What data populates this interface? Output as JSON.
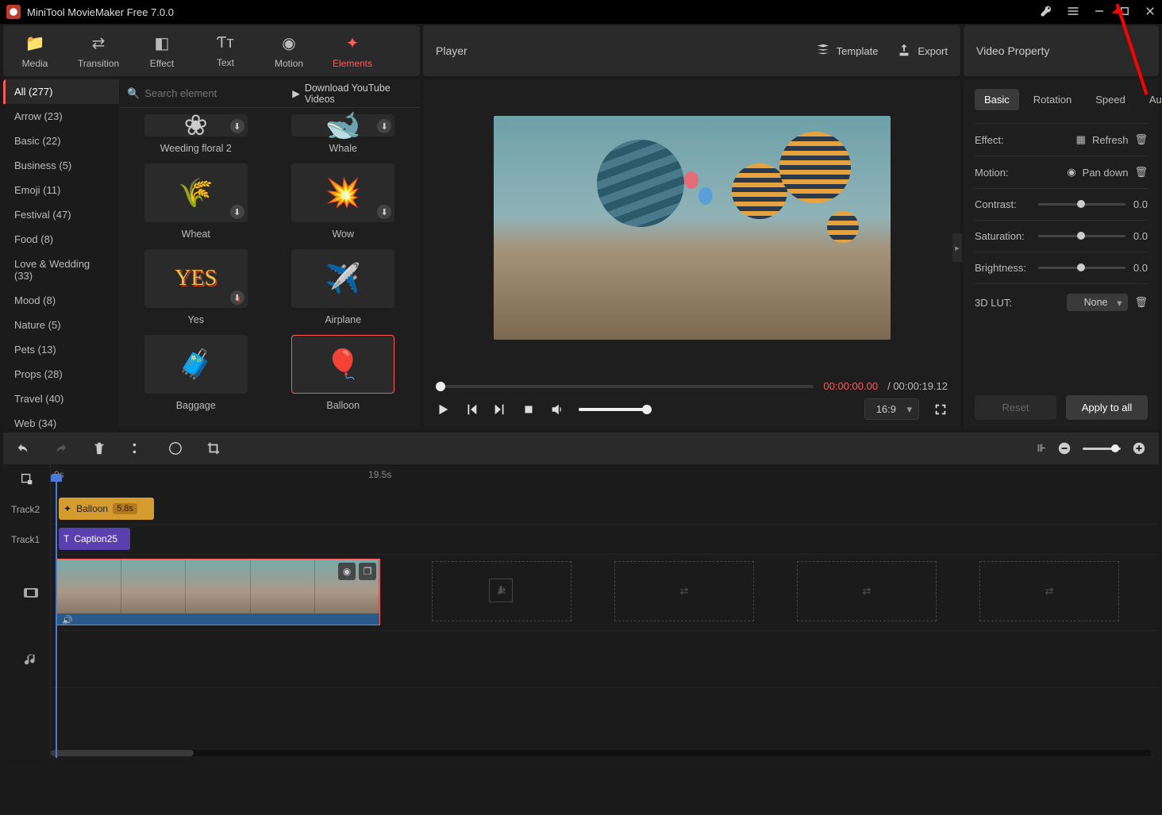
{
  "app": {
    "title": "MiniTool MovieMaker Free 7.0.0"
  },
  "toolbar_tabs": {
    "media": "Media",
    "transition": "Transition",
    "effect": "Effect",
    "text": "Text",
    "motion": "Motion",
    "elements": "Elements"
  },
  "player_header": {
    "label": "Player",
    "template": "Template",
    "export": "Export"
  },
  "property_header": {
    "label": "Video Property"
  },
  "categories": [
    "All (277)",
    "Arrow (23)",
    "Basic (22)",
    "Business (5)",
    "Emoji (11)",
    "Festival (47)",
    "Food (8)",
    "Love & Wedding (33)",
    "Mood (8)",
    "Nature (5)",
    "Pets (13)",
    "Props (28)",
    "Travel (40)",
    "Web (34)"
  ],
  "search_placeholder": "Search element",
  "youtube_link": "Download YouTube Videos",
  "elements": [
    {
      "name": "Weeding floral 2",
      "glyph": "❀",
      "dl": true,
      "partial": true
    },
    {
      "name": "Whale",
      "glyph": "🐋",
      "dl": true,
      "partial": true
    },
    {
      "name": "Wheat",
      "glyph": "🌾",
      "dl": true
    },
    {
      "name": "Wow",
      "glyph": "💥",
      "dl": true
    },
    {
      "name": "Yes",
      "glyph": "YES",
      "dl": true,
      "yes": true
    },
    {
      "name": "Airplane",
      "glyph": "✈️",
      "dl": false
    },
    {
      "name": "Baggage",
      "glyph": "🧳",
      "dl": false
    },
    {
      "name": "Balloon",
      "glyph": "🎈",
      "dl": false,
      "selected": true
    }
  ],
  "playback": {
    "current": "00:00:00.00",
    "total": "/ 00:00:19.12",
    "aspect": "16:9"
  },
  "property": {
    "tabs": {
      "basic": "Basic",
      "rotation": "Rotation",
      "speed": "Speed",
      "audio": "Audio"
    },
    "effect": {
      "label": "Effect:",
      "value": "Refresh"
    },
    "motion": {
      "label": "Motion:",
      "value": "Pan down"
    },
    "contrast": {
      "label": "Contrast:",
      "value": "0.0"
    },
    "saturation": {
      "label": "Saturation:",
      "value": "0.0"
    },
    "brightness": {
      "label": "Brightness:",
      "value": "0.0"
    },
    "lut": {
      "label": "3D LUT:",
      "value": "None"
    },
    "reset": "Reset",
    "apply": "Apply to all"
  },
  "timeline": {
    "ruler": {
      "start": "0s",
      "mid": "19.5s"
    },
    "tracks": {
      "t2": "Track2",
      "t1": "Track1"
    },
    "element_clip": {
      "name": "Balloon",
      "duration": "5.8s"
    },
    "text_clip": {
      "name": "Caption25"
    }
  }
}
